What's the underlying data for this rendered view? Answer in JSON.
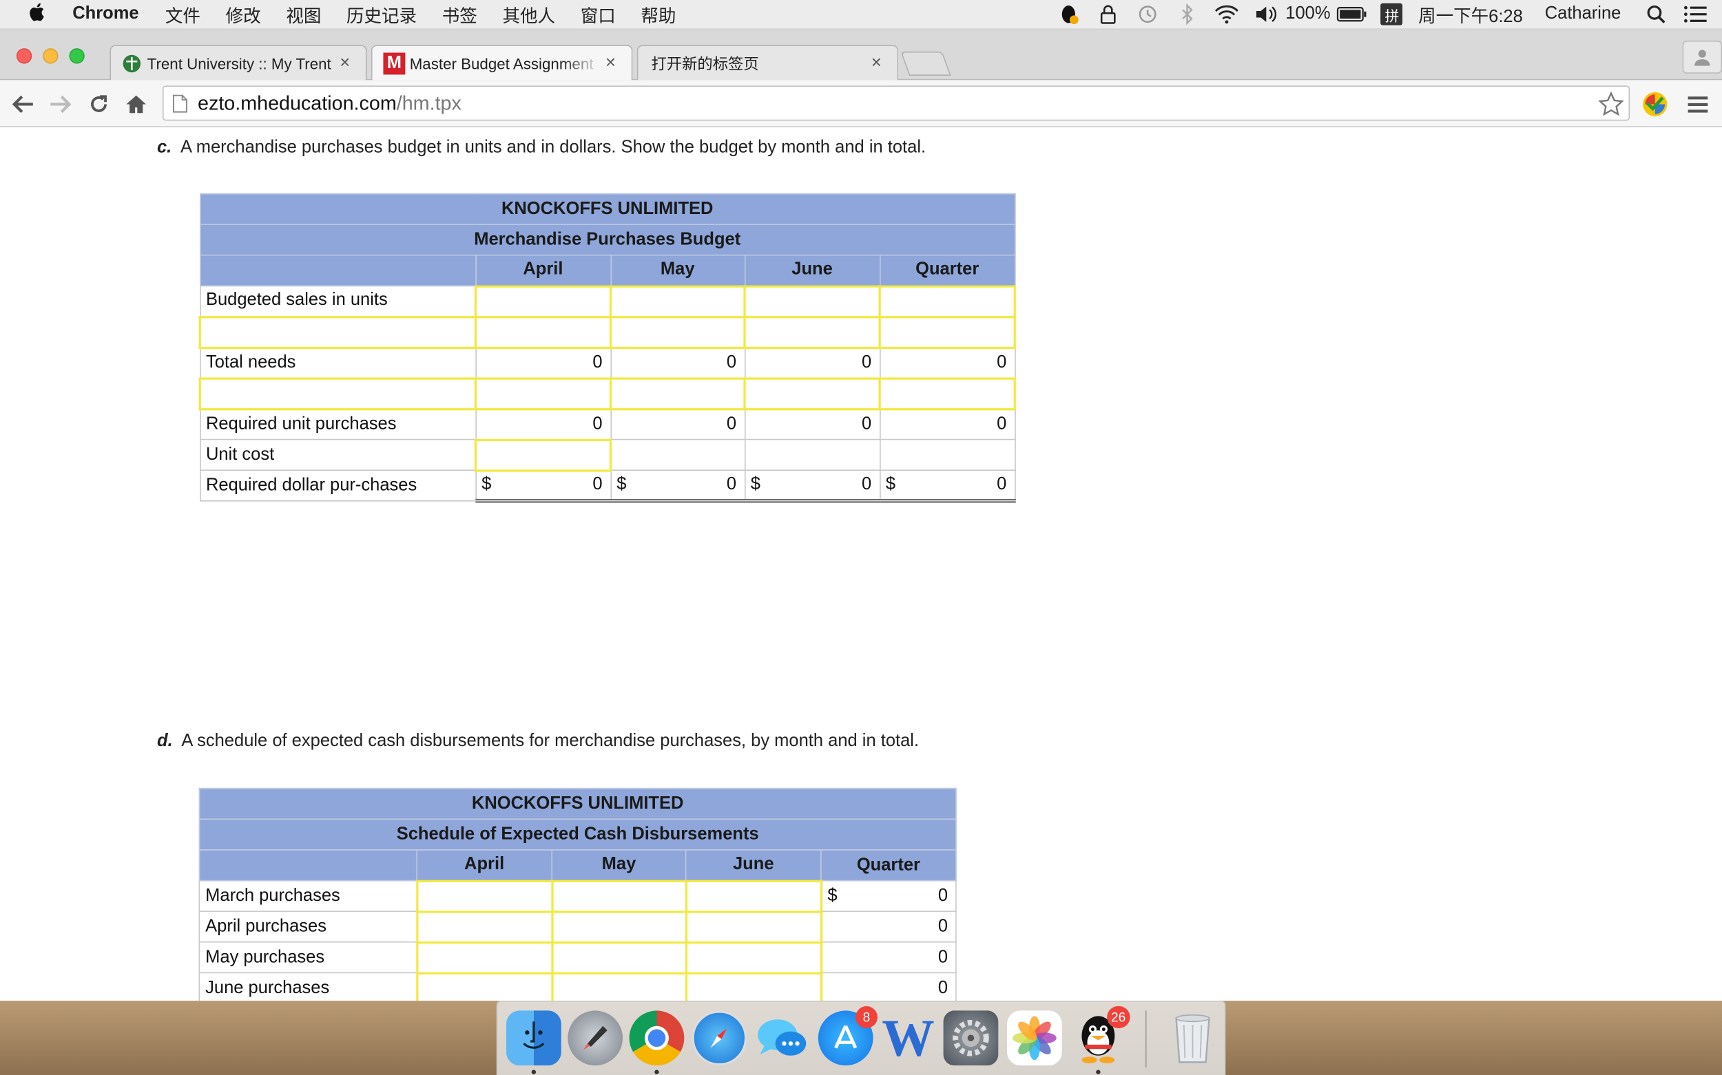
{
  "menubar": {
    "app_name": "Chrome",
    "items": [
      "文件",
      "修改",
      "视图",
      "历史记录",
      "书签",
      "其他人",
      "窗口",
      "帮助"
    ],
    "battery": "100%",
    "ime": "拼",
    "clock": "周一下午6:28",
    "user": "Catharine"
  },
  "tabs": [
    {
      "title": "Trent University :: My Trent",
      "icon": "trent-shield-icon",
      "active": false
    },
    {
      "title": "Master Budget Assignment",
      "icon": "mcgraw-hill-m-icon",
      "active": true
    },
    {
      "title": "打开新的标签页",
      "icon": "",
      "active": false
    }
  ],
  "address": {
    "host": "ezto.mheducation.com",
    "path": "/hm.tpx"
  },
  "section_c": {
    "letter": "c.",
    "prompt": "A merchandise purchases budget in units and in dollars. Show the budget by month and in total.",
    "company": "KNOCKOFFS UNLIMITED",
    "subtitle": "Merchandise Purchases Budget",
    "columns": [
      "April",
      "May",
      "June",
      "Quarter"
    ],
    "rows": {
      "budgeted_sales": "Budgeted sales in units",
      "total_needs": "Total needs",
      "total_needs_values": [
        "0",
        "0",
        "0",
        "0"
      ],
      "required_units": "Required unit purchases",
      "required_units_values": [
        "0",
        "0",
        "0",
        "0"
      ],
      "unit_cost": "Unit cost",
      "required_dollars": "Required dollar pur-chases",
      "required_dollars_values": [
        "0",
        "0",
        "0",
        "0"
      ],
      "currency": "$"
    }
  },
  "section_d": {
    "letter": "d.",
    "prompt": "A schedule of expected cash disbursements for merchandise purchases, by month and in total.",
    "company": "KNOCKOFFS UNLIMITED",
    "subtitle": "Schedule of Expected Cash Disbursements",
    "columns": [
      "April",
      "May",
      "June",
      "Quarter"
    ],
    "rows": [
      {
        "label": "March purchases",
        "quarter": "0"
      },
      {
        "label": "April purchases",
        "quarter": "0"
      },
      {
        "label": "May purchases",
        "quarter": "0"
      },
      {
        "label": "June purchases",
        "quarter": "0"
      }
    ],
    "currency": "$"
  },
  "dock": {
    "appstore_badge": "8",
    "qq_badge": "26"
  }
}
